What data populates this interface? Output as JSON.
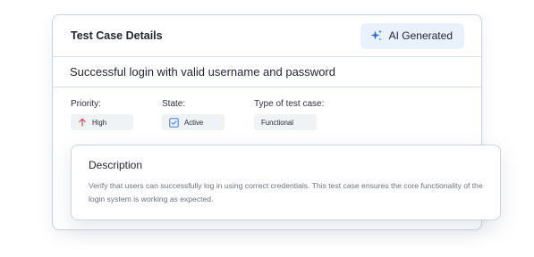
{
  "card": {
    "title": "Test Case Details",
    "ai_badge": {
      "label": "AI Generated",
      "icon": "sparkles-icon"
    },
    "summary": "Successful login with valid username and password",
    "fields": {
      "priority": {
        "label": "Priority:",
        "value": "High",
        "icon": "arrow-up-icon",
        "icon_color": "#e5484d"
      },
      "state": {
        "label": "State:",
        "value": "Active",
        "icon": "checkbox-checked-icon",
        "icon_color": "#3b82f6"
      },
      "type": {
        "label": "Type of test case:",
        "value": "Functional"
      }
    }
  },
  "description": {
    "title": "Description",
    "body": "Verify that users can successfully log in using correct credentials. This test case ensures the core functionality of the login system is working as expected."
  },
  "colors": {
    "accent": "#2f6fdb",
    "badge_bg": "#e8f1fc",
    "border": "#c9d3df",
    "chip_bg": "#f0f3f6"
  }
}
